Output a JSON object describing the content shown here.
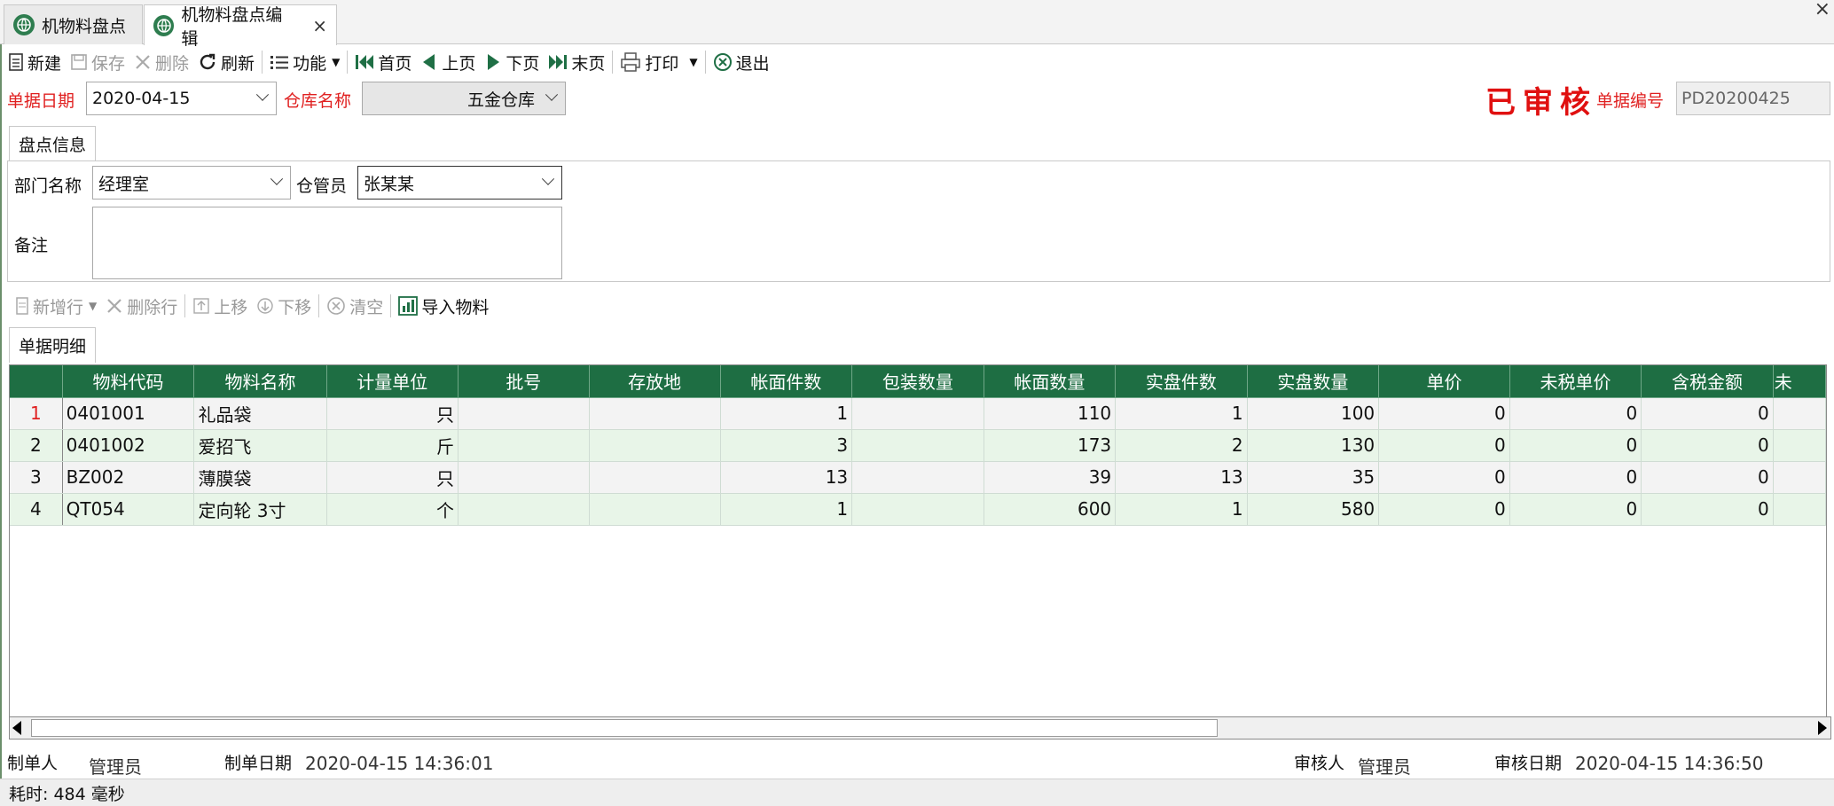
{
  "tabs": [
    {
      "label": "机物料盘点",
      "active": false
    },
    {
      "label": "机物料盘点编辑",
      "active": true
    }
  ],
  "window_close": "×",
  "toolbar": {
    "new": "新建",
    "save": "保存",
    "delete": "删除",
    "refresh": "刷新",
    "function": "功能",
    "first": "首页",
    "prev": "上页",
    "next": "下页",
    "last": "末页",
    "print": "打印",
    "exit": "退出"
  },
  "header": {
    "date_label": "单据日期",
    "date_value": "2020-04-15",
    "warehouse_label": "仓库名称",
    "warehouse_value": "五金仓库",
    "audit_stamp": "已审核",
    "doc_no_label": "单据编号",
    "doc_no_value": "PD20200425"
  },
  "info": {
    "tab_label": "盘点信息",
    "dept_label": "部门名称",
    "dept_value": "经理室",
    "keeper_label": "仓管员",
    "keeper_value": "张某某",
    "remark_label": "备注",
    "remark_value": ""
  },
  "detail_toolbar": {
    "add_row": "新增行",
    "delete_row": "删除行",
    "move_up": "上移",
    "move_down": "下移",
    "clear": "清空",
    "import": "导入物料"
  },
  "detail": {
    "tab_label": "单据明细",
    "columns": [
      "物料代码",
      "物料名称",
      "计量单位",
      "批号",
      "存放地",
      "帐面件数",
      "包装数量",
      "帐面数量",
      "实盘件数",
      "实盘数量",
      "单价",
      "未税单价",
      "含税金额",
      "未"
    ],
    "rows": [
      {
        "no": "1",
        "code": "0401001",
        "name": "礼品袋",
        "unit": "只",
        "batch": "",
        "place": "",
        "book_pcs": "1",
        "pack_qty": "",
        "book_qty": "110",
        "real_pcs": "1",
        "real_qty": "100",
        "price": "0",
        "notax_price": "0",
        "tax_amount": "0"
      },
      {
        "no": "2",
        "code": "0401002",
        "name": "爱招飞",
        "unit": "斤",
        "batch": "",
        "place": "",
        "book_pcs": "3",
        "pack_qty": "",
        "book_qty": "173",
        "real_pcs": "2",
        "real_qty": "130",
        "price": "0",
        "notax_price": "0",
        "tax_amount": "0"
      },
      {
        "no": "3",
        "code": "BZ002",
        "name": "薄膜袋",
        "unit": "只",
        "batch": "",
        "place": "",
        "book_pcs": "13",
        "pack_qty": "",
        "book_qty": "39",
        "real_pcs": "13",
        "real_qty": "35",
        "price": "0",
        "notax_price": "0",
        "tax_amount": "0"
      },
      {
        "no": "4",
        "code": "QT054",
        "name": "定向轮 3寸",
        "unit": "个",
        "batch": "",
        "place": "",
        "book_pcs": "1",
        "pack_qty": "",
        "book_qty": "600",
        "real_pcs": "1",
        "real_qty": "580",
        "price": "0",
        "notax_price": "0",
        "tax_amount": "0"
      }
    ]
  },
  "footer": {
    "maker_label": "制单人",
    "maker_value": "管理员",
    "make_date_label": "制单日期",
    "make_date_value": "2020-04-15 14:36:01",
    "auditor_label": "审核人",
    "auditor_value": "管理员",
    "audit_date_label": "审核日期",
    "audit_date_value": "2020-04-15 14:36:50"
  },
  "status": "耗时: 484 毫秒",
  "colors": {
    "grid_header": "#1e6e43",
    "required_label": "#e02020",
    "stamp": "#e01010",
    "even_row": "#e8f5e8"
  }
}
